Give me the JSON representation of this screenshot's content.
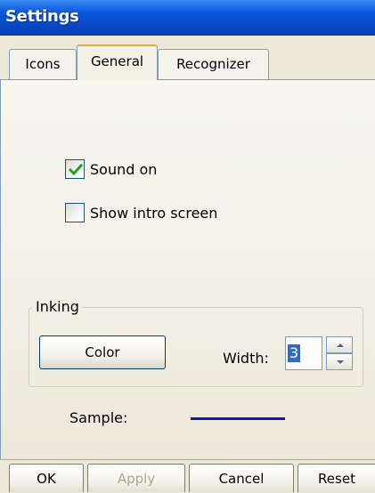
{
  "window": {
    "title": "Settings"
  },
  "tabs": [
    {
      "label": "Icons",
      "active": false
    },
    {
      "label": "General",
      "active": true
    },
    {
      "label": "Recognizer",
      "active": false
    }
  ],
  "general": {
    "sound_on": {
      "label": "Sound on",
      "checked": true
    },
    "show_intro": {
      "label": "Show intro screen",
      "checked": false
    }
  },
  "inking": {
    "legend": "Inking",
    "color_button": "Color",
    "width_label": "Width:",
    "width_value": "3",
    "sample_label": "Sample:",
    "sample_color": "#1010D8"
  },
  "buttons": {
    "ok": "OK",
    "apply": "Apply",
    "cancel": "Cancel",
    "reset": "Reset"
  },
  "colors": {
    "titlebar": "#0A57DB",
    "dialog_bg": "#ECE9D8",
    "selection": "#316AC5",
    "check": "#21A121"
  }
}
